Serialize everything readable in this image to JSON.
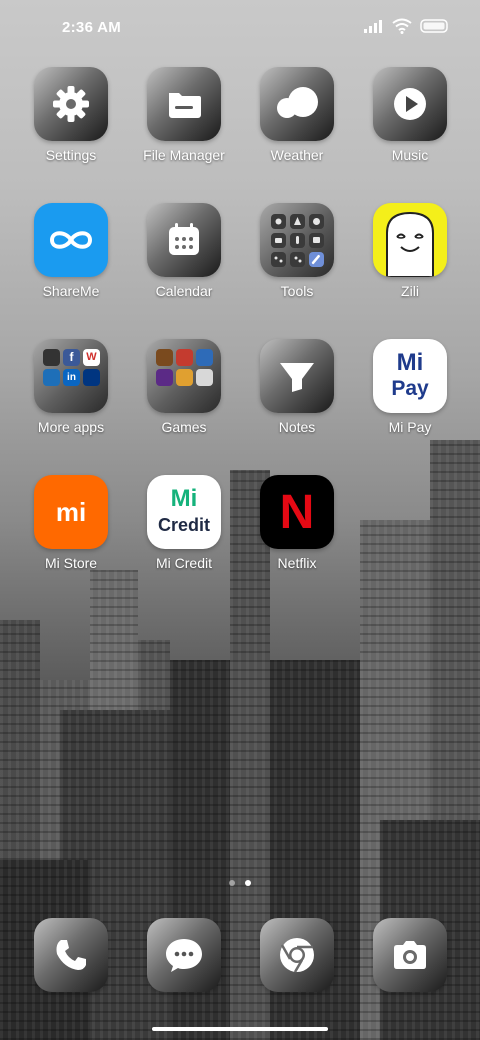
{
  "status_bar": {
    "time": "2:36 AM"
  },
  "apps": [
    {
      "label": "Settings",
      "icon": "gear-icon"
    },
    {
      "label": "File Manager",
      "icon": "folder-icon"
    },
    {
      "label": "Weather",
      "icon": "cloud-icon"
    },
    {
      "label": "Music",
      "icon": "play-icon"
    },
    {
      "label": "ShareMe",
      "icon": "infinity-icon"
    },
    {
      "label": "Calendar",
      "icon": "calendar-icon"
    },
    {
      "label": "Tools",
      "icon": "tools-grid-icon"
    },
    {
      "label": "Zili",
      "icon": "ghost-face-icon"
    },
    {
      "label": "More apps",
      "icon": "folder-grid-icon"
    },
    {
      "label": "Games",
      "icon": "folder-grid-icon"
    },
    {
      "label": "Notes",
      "icon": "funnel-icon"
    },
    {
      "label": "Mi Pay",
      "icon": "mi-pay-logo"
    },
    {
      "label": "Mi Store",
      "icon": "mi-logo"
    },
    {
      "label": "Mi Credit",
      "icon": "mi-credit-logo"
    },
    {
      "label": "Netflix",
      "icon": "netflix-n-logo"
    }
  ],
  "logos": {
    "mi_pay": {
      "top": "Mi",
      "bottom": "Pay"
    },
    "mi_credit": {
      "top": "Mi",
      "bottom": "Credit"
    },
    "netflix": "N",
    "mi_store": "mi",
    "more_apps_mini": [
      "f",
      "W",
      "in"
    ]
  },
  "dock": [
    {
      "name": "Phone",
      "icon": "phone-icon"
    },
    {
      "name": "Messages",
      "icon": "chat-bubble-icon"
    },
    {
      "name": "Chrome",
      "icon": "chrome-icon"
    },
    {
      "name": "Camera",
      "icon": "camera-icon"
    }
  ],
  "page_indicator": {
    "count": 2,
    "active": 1
  },
  "colors": {
    "mi_orange": "#ff6900",
    "shareme_blue": "#1a9bf0",
    "zili_yellow": "#f4ef1a",
    "netflix_red": "#e50914",
    "mi_green": "#15b27b",
    "mi_blue": "#1f3b8c"
  }
}
